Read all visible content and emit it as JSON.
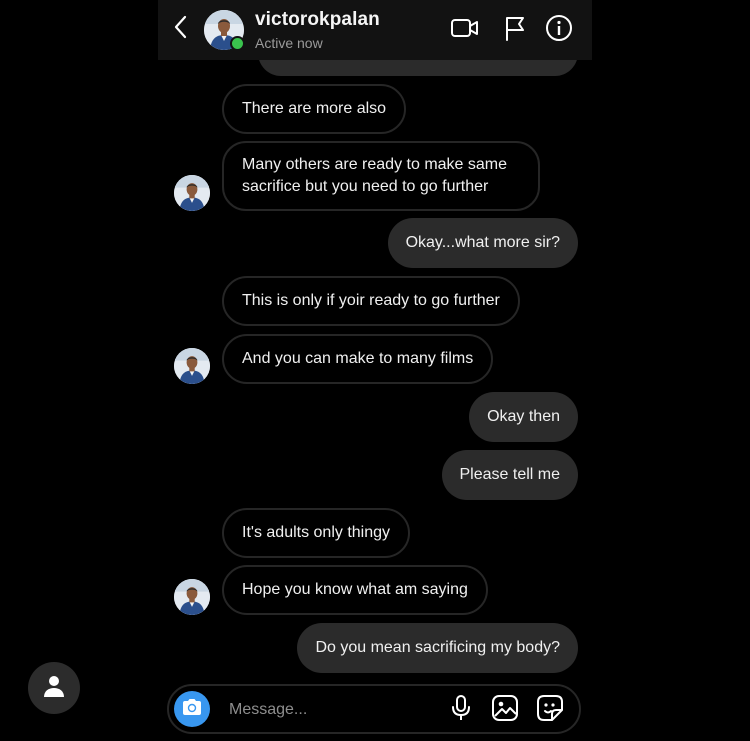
{
  "header": {
    "username": "victorokpalan",
    "status": "Active now",
    "icons": [
      "back-chevron-icon",
      "video-call-icon",
      "flag-icon",
      "info-icon"
    ]
  },
  "messages": [
    {
      "side": "in",
      "text": "There are more also"
    },
    {
      "side": "in",
      "text": "Many others are ready to make same sacrifice but you need to go further"
    },
    {
      "side": "out",
      "text": "Okay...what more sir?"
    },
    {
      "side": "in",
      "text": "This is only if yoir ready to go further"
    },
    {
      "side": "in",
      "text": "And you can make to many films"
    },
    {
      "side": "out",
      "text": "Okay then"
    },
    {
      "side": "out",
      "text": "Please tell me"
    },
    {
      "side": "in",
      "text": "It's adults only thingy"
    },
    {
      "side": "in",
      "text": "Hope you know what am saying"
    },
    {
      "side": "out",
      "text": "Do you mean sacrificing my body?"
    }
  ],
  "composer": {
    "placeholder": "Message...",
    "icons": [
      "camera-icon",
      "microphone-icon",
      "gallery-icon",
      "sticker-icon"
    ]
  },
  "colors": {
    "background": "#000000",
    "header": "#121212",
    "outgoing_bubble": "#2b2b2b",
    "incoming_border": "#262626",
    "camera_button": "#3897f0",
    "online_dot": "#3ac34e"
  }
}
